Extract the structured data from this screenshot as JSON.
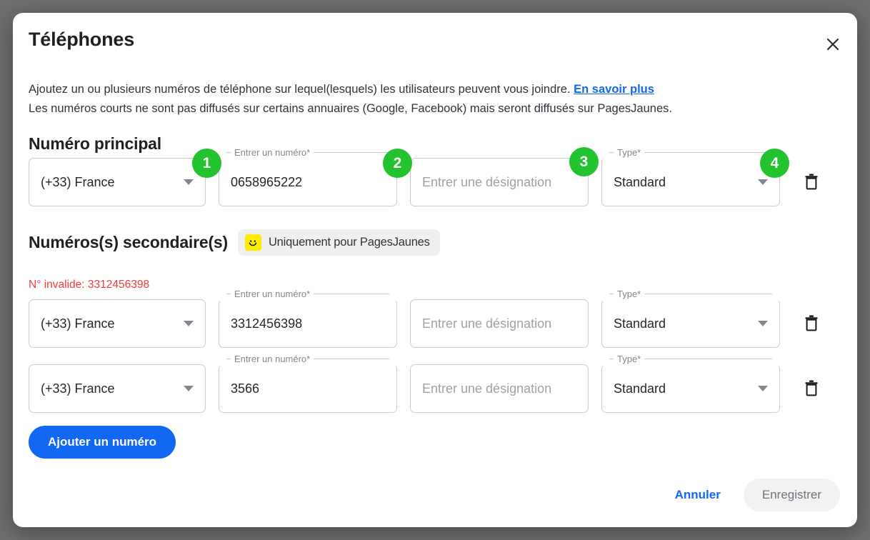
{
  "dialog": {
    "title": "Téléphones",
    "close_icon": "close-icon",
    "description_part1": "Ajoutez un ou plusieurs numéros de téléphone sur lequel(lesquels) les utilisateurs peuvent vous joindre. ",
    "description_link": "En savoir plus",
    "description_line2": "Les numéros courts ne sont pas diffusés sur certains annuaires (Google, Facebook) mais seront diffusés sur PagesJaunes."
  },
  "sections": {
    "primary_title": "Numéro principal",
    "secondary_title": "Numéros(s) secondaire(s)",
    "secondary_badge": "Uniquement pour PagesJaunes",
    "secondary_badge_icon": "pagesjaunes-smiley-icon",
    "error_message": "N° invalide: 3312456398"
  },
  "labels": {
    "number_label": "Entrer un numéro*",
    "type_label": "Type*",
    "designation_placeholder": "Entrer une désignation",
    "delete_icon": "trash-icon",
    "dropdown_icon": "chevron-down-icon"
  },
  "rows": [
    {
      "country": "(+33) France",
      "number": "0658965222",
      "designation": "",
      "type": "Standard"
    },
    {
      "country": "(+33) France",
      "number": "3312456398",
      "designation": "",
      "type": "Standard"
    },
    {
      "country": "(+33) France",
      "number": "3566",
      "designation": "",
      "type": "Standard"
    }
  ],
  "markers": [
    "1",
    "2",
    "3",
    "4"
  ],
  "buttons": {
    "add_number": "Ajouter un numéro",
    "cancel": "Annuler",
    "save": "Enregistrer"
  },
  "colors": {
    "accent_blue": "#1268f3",
    "marker_green": "#22c32e",
    "error_red": "#f03b3b",
    "pagesjaunes_yellow": "#ffec00"
  }
}
